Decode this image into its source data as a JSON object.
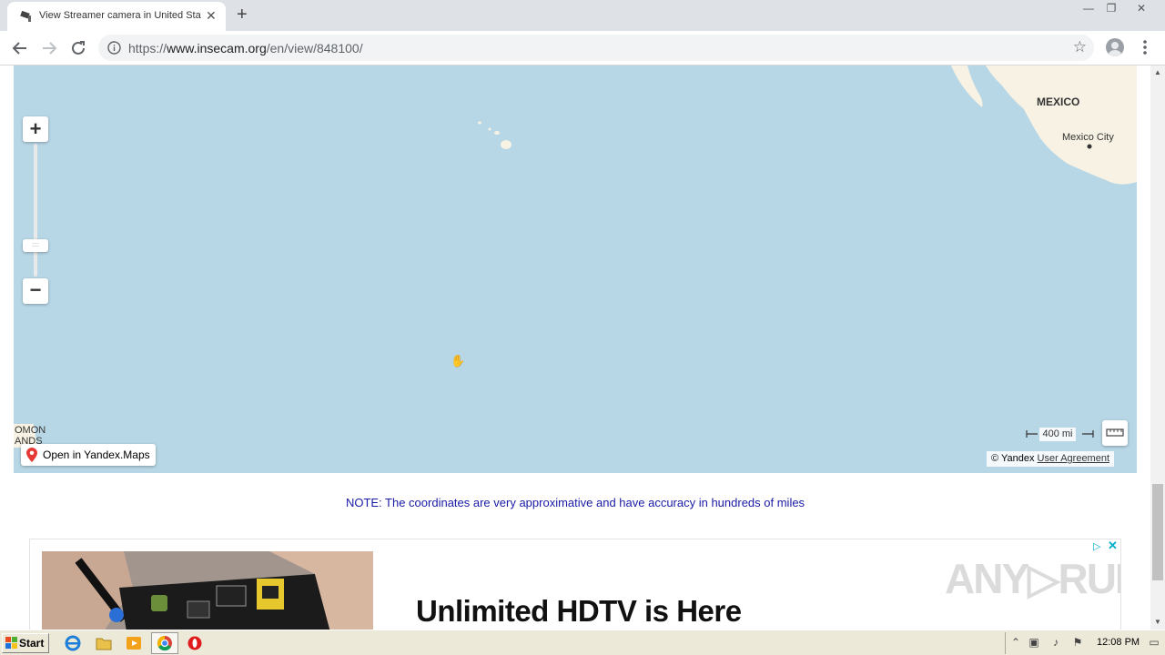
{
  "browser": {
    "tab_title": "View Streamer camera in United States",
    "tab_close": "✕",
    "new_tab": "+",
    "url_prefix": "https://",
    "url_host": "www.insecam.org",
    "url_path": "/en/view/848100/",
    "star": "☆",
    "window_minimize": "—",
    "window_restore": "❐",
    "window_close": "✕"
  },
  "map": {
    "zoom_in": "+",
    "zoom_out": "−",
    "zoom_handle": "::::",
    "labels": {
      "mexico": "MEXICO",
      "mexico_city": "Mexico City",
      "solomon_line1": "OMON",
      "solomon_line2": "ANDS"
    },
    "open_in_yandex": "Open in Yandex.Maps",
    "scale_label": "400 mi",
    "copyright_prefix": "© Yandex",
    "user_agreement": "User Agreement",
    "colors": {
      "water": "#b8d7e6",
      "land": "#f7f2e3"
    }
  },
  "note": "NOTE: The coordinates are very approximative and have accuracy in hundreds of miles",
  "ad": {
    "headline": "Unlimited HDTV is Here",
    "watermark": "ANY▷RUN",
    "adchoices": "▷",
    "close": "✕"
  },
  "scrollbar": {
    "up": "▲",
    "down": "▼"
  },
  "taskbar": {
    "start_label": "Start",
    "clock": "12:08 PM",
    "tray_expand": "⌃"
  }
}
